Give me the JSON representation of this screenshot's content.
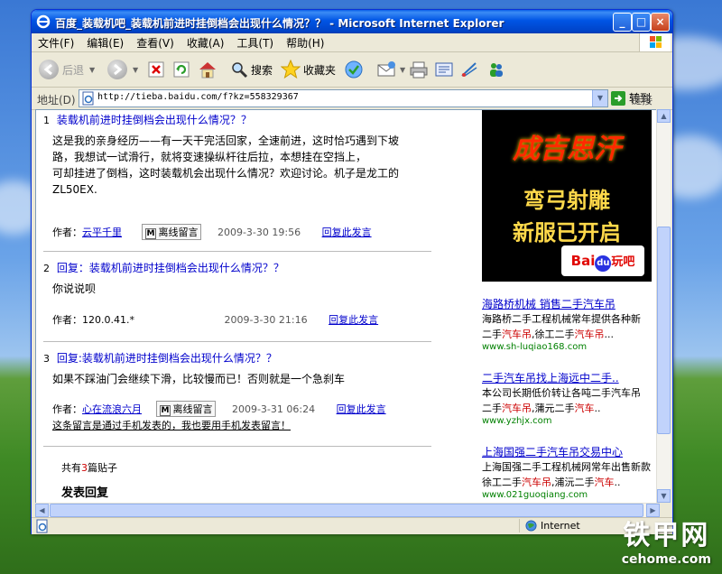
{
  "window": {
    "title": "百度_装载机吧_装载机前进时挂倒档会出现什么情况？？ - Microsoft Internet Explorer",
    "min_label": "_",
    "max_label": "□",
    "close_label": "×"
  },
  "menu": [
    "文件(F)",
    "编辑(E)",
    "查看(V)",
    "收藏(A)",
    "工具(T)",
    "帮助(H)"
  ],
  "toolbar": {
    "back": "后退",
    "search": "搜索",
    "favorites": "收藏夹"
  },
  "address": {
    "label": "地址(D)",
    "url": "http://tieba.baidu.com/f?kz=558329367",
    "go": "转到",
    "links": "链接"
  },
  "posts": [
    {
      "num": "1",
      "title": "装载机前进时挂倒档会出现什么情况？？",
      "body_lines": [
        "这是我的亲身经历——有一天干完活回家，全速前进，这时恰巧遇到下坡",
        "路，我想试一试滑行，就将变速操纵杆往后拉，本想挂在空挡上，",
        "可却挂进了倒档，这时装载机会出现什么情况？欢迎讨论。机子是龙工的",
        "ZL50EX."
      ],
      "author_label": "作者：",
      "author": "云平千里",
      "msg_button": "离线留言",
      "time": "2009-3-30 19:56",
      "reply": "回复此发言"
    },
    {
      "num": "2",
      "title": "回复：装载机前进时挂倒档会出现什么情况？？",
      "body_lines": [
        "你说说呗"
      ],
      "author_label": "作者：",
      "author": "120.0.41.*",
      "time": "2009-3-30 21:16",
      "reply": "回复此发言"
    },
    {
      "num": "3",
      "title": "回复:装载机前进时挂倒档会出现什么情况？？",
      "body_lines": [
        "如果不踩油门会继续下滑，比较慢而已！否则就是一个急刹车"
      ],
      "author_label": "作者：",
      "author": "心在流浪六月",
      "msg_button": "离线留言",
      "time": "2009-3-31 06:24",
      "reply": "回复此发言",
      "mobile_note": "这条留言是通过手机发表的，我也要用手机发表留言！"
    }
  ],
  "summary": {
    "prefix": "共有",
    "count": "3",
    "suffix": "篇贴子",
    "reply_heading": "发表回复"
  },
  "banner": {
    "top_text": "",
    "game_title": "成吉思汗",
    "line1": "弯弓射雕",
    "line2": "新服已开启",
    "logo_text": "Bai",
    "logo_du": "du",
    "logo_suffix": "玩吧"
  },
  "ads": [
    {
      "headline": "海路桥机械 销售二手汽车吊",
      "desc1_pre": "海路桥二手工程机械常年提供各种新",
      "desc2_pre": "二手",
      "desc2_red": "汽车吊",
      "desc2_mid": ",徐工二手",
      "desc2_red2": "汽车吊",
      "desc2_post": "...",
      "url": "www.sh-luqiao168.com"
    },
    {
      "headline": "二手汽车吊找上海远中二手..",
      "desc1_pre": "本公司长期低价转让各吨二手汽车吊",
      "desc2_pre": "二手",
      "desc2_red": "汽车吊",
      "desc2_mid": ",蒲元二手",
      "desc2_red2": "汽车",
      "desc2_post": "..",
      "url": "www.yzhjx.com"
    },
    {
      "headline": "上海国强二手汽车吊交易中心",
      "desc1_pre": "上海国强二手工程机械网常年出售新款",
      "desc2_pre": "徐工二手",
      "desc2_red": "汽车吊",
      "desc2_mid": ",浦沅二手",
      "desc2_red2": "汽车",
      "desc2_post": "..",
      "url": "www.021guoqiang.com"
    }
  ],
  "status": {
    "zone": "Internet"
  },
  "watermark": {
    "cn": "铁甲网",
    "en": "cehome.com"
  }
}
